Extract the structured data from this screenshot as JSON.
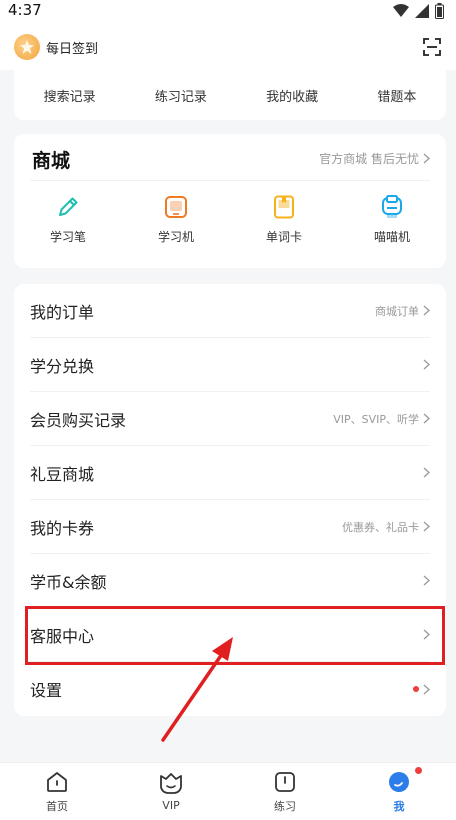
{
  "status_bar": {
    "time": "4:37"
  },
  "header": {
    "checkin_label": "每日签到"
  },
  "records": {
    "items": [
      {
        "label": "搜索记录"
      },
      {
        "label": "练习记录"
      },
      {
        "label": "我的收藏"
      },
      {
        "label": "错题本"
      }
    ]
  },
  "shop": {
    "title": "商城",
    "subtitle": "官方商城 售后无忧",
    "items": [
      {
        "label": "学习笔",
        "icon": "pen-icon",
        "color": "#1fbfb0"
      },
      {
        "label": "学习机",
        "icon": "tablet-icon",
        "color": "#f07a22"
      },
      {
        "label": "单词卡",
        "icon": "card-icon",
        "color": "#f5b21b"
      },
      {
        "label": "喵喵机",
        "icon": "printer-icon",
        "color": "#1ba8e8"
      }
    ]
  },
  "menu": {
    "items": [
      {
        "label": "我的订单",
        "hint": "商城订单"
      },
      {
        "label": "学分兑换",
        "hint": ""
      },
      {
        "label": "会员购买记录",
        "hint": "VIP、SVIP、听学"
      },
      {
        "label": "礼豆商城",
        "hint": ""
      },
      {
        "label": "我的卡券",
        "hint": "优惠券、礼品卡"
      },
      {
        "label": "学币&余额",
        "hint": ""
      },
      {
        "label": "客服中心",
        "hint": ""
      },
      {
        "label": "设置",
        "hint": ""
      }
    ]
  },
  "tabbar": {
    "tabs": [
      {
        "label": "首页"
      },
      {
        "label": "VIP"
      },
      {
        "label": "练习"
      },
      {
        "label": "我"
      }
    ]
  },
  "colors": {
    "accent": "#2b7de9",
    "annotation": "#e02020",
    "notify": "#f03d3d"
  }
}
